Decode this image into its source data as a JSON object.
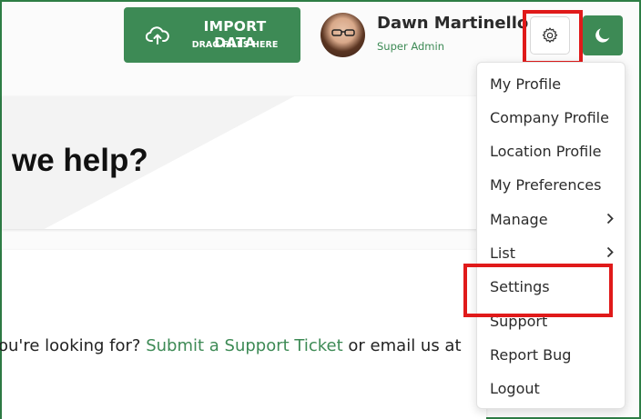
{
  "header": {
    "import_button": {
      "title": "IMPORT DATA",
      "subtitle": "DRAG FILES HERE",
      "icon": "cloud-upload-icon"
    },
    "user": {
      "name": "Dawn Martinello",
      "role": "Super Admin"
    },
    "settings_icon": "gear-icon",
    "theme_icon": "moon-icon"
  },
  "hero": {
    "title": "we help?"
  },
  "help": {
    "prefix": "ou're looking for?",
    "link": "Submit a Support Ticket",
    "suffix": "or email us at"
  },
  "menu": {
    "items": [
      {
        "label": "My Profile"
      },
      {
        "label": "Company Profile"
      },
      {
        "label": "Location Profile"
      },
      {
        "label": "My Preferences"
      },
      {
        "label": "Manage",
        "has_submenu": true
      },
      {
        "label": "List",
        "has_submenu": true
      },
      {
        "label": "Settings"
      },
      {
        "label": "Support"
      },
      {
        "label": "Report Bug"
      },
      {
        "label": "Logout"
      }
    ]
  },
  "colors": {
    "brand": "#3d8a55",
    "highlight": "#e01a1a"
  }
}
